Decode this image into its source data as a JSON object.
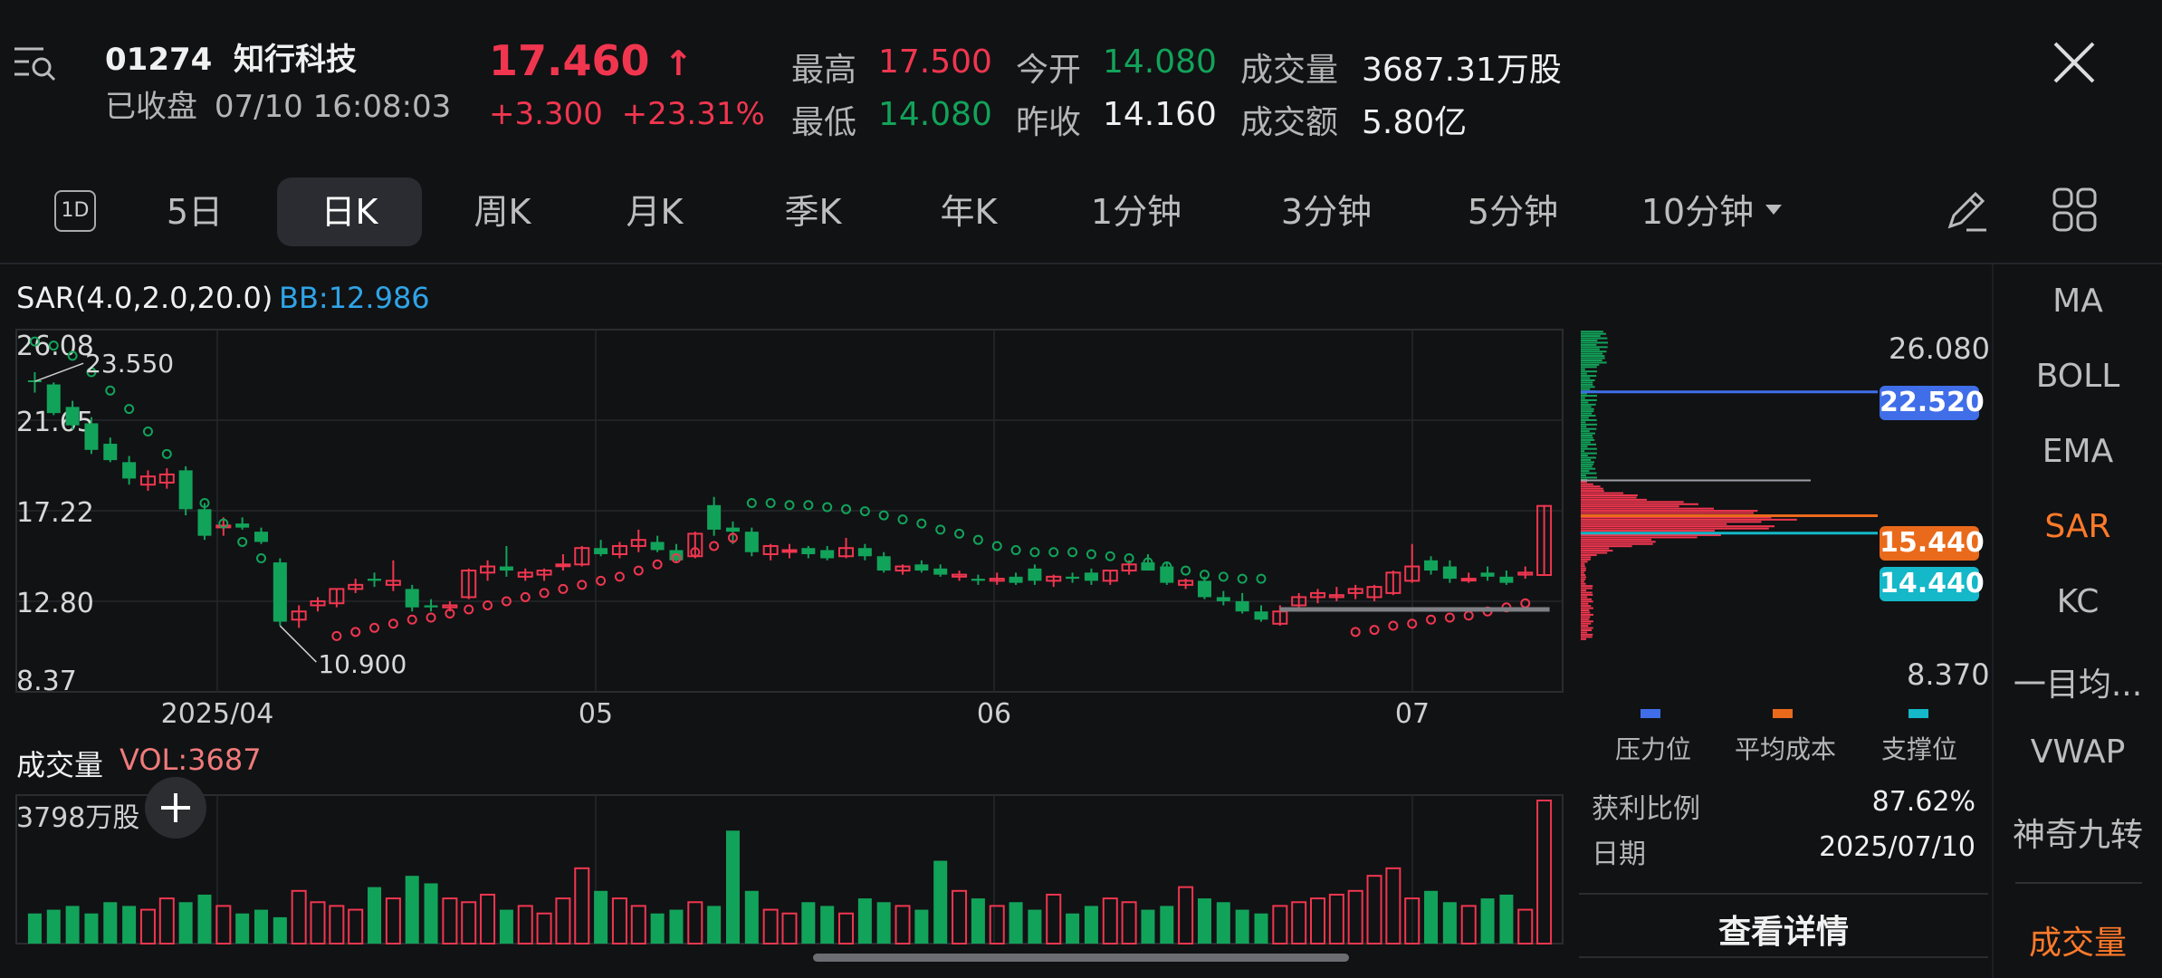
{
  "header": {
    "code": "01274",
    "name": "知行科技",
    "status": "已收盘",
    "datetime": "07/10 16:08:03",
    "price": "17.460",
    "change": "+3.300",
    "change_pct": "+23.31%",
    "stats": {
      "high_label": "最高",
      "high": "17.500",
      "open_label": "今开",
      "open": "14.080",
      "vol_label": "成交量",
      "vol": "3687.31万股",
      "low_label": "最低",
      "low": "14.080",
      "prev_label": "昨收",
      "prev": "14.160",
      "amt_label": "成交额",
      "amt": "5.80亿"
    }
  },
  "tabs": {
    "oned": "1D",
    "items": [
      "5日",
      "日K",
      "周K",
      "月K",
      "季K",
      "年K",
      "1分钟",
      "3分钟",
      "5分钟",
      "10分钟"
    ],
    "active": "日K"
  },
  "indicator": {
    "label": "SAR(4.0,2.0,20.0)",
    "bb": "BB:12.986"
  },
  "volume_panel": {
    "label": "成交量",
    "vol": "VOL:3687",
    "scale": "3798万股"
  },
  "right_menu": [
    "MA",
    "BOLL",
    "EMA",
    "SAR",
    "KC",
    "一目均...",
    "VWAP",
    "神奇九转"
  ],
  "right_menu_active": "SAR",
  "bottom_menu": "成交量",
  "chip": {
    "top": "26.080",
    "bottom": "8.370",
    "pressure": "22.520",
    "avg_cost": "15.440",
    "support": "14.440",
    "legend": [
      "压力位",
      "平均成本",
      "支撑位"
    ],
    "profit_label": "获利比例",
    "profit": "87.62%",
    "date_label": "日期",
    "date": "2025/07/10",
    "detail": "查看详情"
  },
  "chart_data": {
    "type": "candlestick",
    "y_ticks": [
      "26.08",
      "21.65",
      "17.22",
      "12.80",
      "8.37"
    ],
    "ylim": [
      8.37,
      26.08
    ],
    "x_ticks": [
      "2025/04",
      "05",
      "06",
      "07"
    ],
    "annotations": {
      "high": "23.550",
      "low": "10.900"
    },
    "candles": [
      [
        23.6,
        24.0,
        23.0,
        23.55
      ],
      [
        23.4,
        23.5,
        21.9,
        22.0
      ],
      [
        22.3,
        22.6,
        21.2,
        21.4
      ],
      [
        21.5,
        21.8,
        20.0,
        20.2
      ],
      [
        20.5,
        20.8,
        19.6,
        19.7
      ],
      [
        19.6,
        19.9,
        18.5,
        18.8
      ],
      [
        18.5,
        19.2,
        18.2,
        18.9
      ],
      [
        18.6,
        19.3,
        18.3,
        19.0
      ],
      [
        19.2,
        19.4,
        17.0,
        17.3
      ],
      [
        17.3,
        17.6,
        15.8,
        16.0
      ],
      [
        16.5,
        16.9,
        16.0,
        16.5
      ],
      [
        16.6,
        16.9,
        16.3,
        16.4
      ],
      [
        16.2,
        16.4,
        15.6,
        15.7
      ],
      [
        14.7,
        14.9,
        11.6,
        11.8
      ],
      [
        11.9,
        12.6,
        11.5,
        12.3
      ],
      [
        12.6,
        13.0,
        12.3,
        12.8
      ],
      [
        12.7,
        13.4,
        12.5,
        13.4
      ],
      [
        13.4,
        13.9,
        13.2,
        13.6
      ],
      [
        13.9,
        14.2,
        13.5,
        13.8
      ],
      [
        13.6,
        14.8,
        13.3,
        13.8
      ],
      [
        13.4,
        13.6,
        12.3,
        12.5
      ],
      [
        12.6,
        12.9,
        12.3,
        12.5
      ],
      [
        12.5,
        12.8,
        12.3,
        12.6
      ],
      [
        13.0,
        14.4,
        12.9,
        14.3
      ],
      [
        14.2,
        14.8,
        13.8,
        14.5
      ],
      [
        14.5,
        15.5,
        14.0,
        14.3
      ],
      [
        14.0,
        14.4,
        13.8,
        14.2
      ],
      [
        14.1,
        14.4,
        13.8,
        14.3
      ],
      [
        14.6,
        15.1,
        14.3,
        14.6
      ],
      [
        14.6,
        15.5,
        14.5,
        15.4
      ],
      [
        15.4,
        15.8,
        15.0,
        15.1
      ],
      [
        15.1,
        15.7,
        14.9,
        15.5
      ],
      [
        15.5,
        16.3,
        15.2,
        15.8
      ],
      [
        15.7,
        16.0,
        15.2,
        15.3
      ],
      [
        15.3,
        15.6,
        14.7,
        14.8
      ],
      [
        15.0,
        16.2,
        14.9,
        16.1
      ],
      [
        17.5,
        17.9,
        16.0,
        16.3
      ],
      [
        16.4,
        16.7,
        15.6,
        16.2
      ],
      [
        16.2,
        16.4,
        15.0,
        15.2
      ],
      [
        15.1,
        15.6,
        14.8,
        15.5
      ],
      [
        15.3,
        15.6,
        14.9,
        15.3
      ],
      [
        15.4,
        15.5,
        14.9,
        15.1
      ],
      [
        15.3,
        15.5,
        14.8,
        14.9
      ],
      [
        15.0,
        15.9,
        14.9,
        15.4
      ],
      [
        15.4,
        15.6,
        14.8,
        15.0
      ],
      [
        15.0,
        15.2,
        14.2,
        14.3
      ],
      [
        14.3,
        14.6,
        14.1,
        14.5
      ],
      [
        14.6,
        14.8,
        14.2,
        14.3
      ],
      [
        14.4,
        14.6,
        14.0,
        14.1
      ],
      [
        14.0,
        14.3,
        13.8,
        14.1
      ],
      [
        13.9,
        14.1,
        13.6,
        13.8
      ],
      [
        13.8,
        14.2,
        13.6,
        13.9
      ],
      [
        14.0,
        14.2,
        13.6,
        13.7
      ],
      [
        14.4,
        14.6,
        13.6,
        13.8
      ],
      [
        13.8,
        14.1,
        13.5,
        14.0
      ],
      [
        14.0,
        14.2,
        13.7,
        13.9
      ],
      [
        14.2,
        14.4,
        13.6,
        13.8
      ],
      [
        13.8,
        14.3,
        13.6,
        14.3
      ],
      [
        14.3,
        14.8,
        14.1,
        14.6
      ],
      [
        14.7,
        15.1,
        14.3,
        14.3
      ],
      [
        14.5,
        14.7,
        13.6,
        13.7
      ],
      [
        13.6,
        13.9,
        13.4,
        13.8
      ],
      [
        13.8,
        14.0,
        12.9,
        13.0
      ],
      [
        13.0,
        13.3,
        12.6,
        12.8
      ],
      [
        12.8,
        13.2,
        12.2,
        12.3
      ],
      [
        12.3,
        12.6,
        11.8,
        11.9
      ],
      [
        11.7,
        12.6,
        11.6,
        12.3
      ],
      [
        12.6,
        13.2,
        12.4,
        13.0
      ],
      [
        13.0,
        13.4,
        12.7,
        13.2
      ],
      [
        13.0,
        13.5,
        12.8,
        13.1
      ],
      [
        13.2,
        13.6,
        12.9,
        13.4
      ],
      [
        13.0,
        13.6,
        12.8,
        13.5
      ],
      [
        13.2,
        14.3,
        13.1,
        14.2
      ],
      [
        13.8,
        15.6,
        13.7,
        14.5
      ],
      [
        14.8,
        15.0,
        14.1,
        14.3
      ],
      [
        14.5,
        14.8,
        13.7,
        13.9
      ],
      [
        13.9,
        14.2,
        13.7,
        13.9
      ],
      [
        14.2,
        14.5,
        13.8,
        14.0
      ],
      [
        14.0,
        14.3,
        13.6,
        13.7
      ],
      [
        14.1,
        14.5,
        13.9,
        14.2
      ],
      [
        14.08,
        17.5,
        14.08,
        17.46
      ]
    ],
    "sar": [
      {
        "start": 0,
        "values": [
          25.5,
          25.3,
          24.8,
          24.0,
          23.1,
          22.2,
          21.1,
          20.0,
          18.9,
          17.6,
          16.6,
          15.7,
          14.9,
          14.2
        ]
      },
      {
        "start": 16,
        "values": [
          11.1,
          11.3,
          11.5,
          11.7,
          11.9,
          12.0,
          12.2,
          12.4,
          12.6,
          12.8,
          13.0,
          13.2,
          13.4,
          13.6,
          13.8,
          14.0,
          14.3,
          14.6,
          14.9,
          15.2,
          15.5,
          15.9
        ]
      },
      {
        "start": 38,
        "values": [
          17.6,
          17.6,
          17.5,
          17.5,
          17.4,
          17.3,
          17.2,
          17.0,
          16.8,
          16.6,
          16.3,
          16.1,
          15.8,
          15.5,
          15.3,
          15.2,
          15.2,
          15.2,
          15.1,
          15.0,
          14.9,
          14.7,
          14.5,
          14.3,
          14.1,
          14.0,
          13.9,
          13.9
        ]
      },
      {
        "start": 70,
        "values": [
          11.3,
          11.4,
          11.6,
          11.7,
          11.9,
          12.0,
          12.1,
          12.3,
          12.5,
          12.7
        ]
      }
    ],
    "volume": [
      8,
      9,
      10,
      8,
      11,
      10,
      9,
      12,
      11,
      13,
      10,
      8,
      9,
      7,
      14,
      11,
      10,
      9,
      15,
      12,
      18,
      16,
      12,
      11,
      13,
      9,
      10,
      8,
      12,
      20,
      14,
      12,
      10,
      8,
      9,
      11,
      10,
      30,
      14,
      9,
      8,
      11,
      10,
      8,
      12,
      11,
      10,
      9,
      22,
      14,
      12,
      10,
      11,
      9,
      13,
      8,
      10,
      12,
      11,
      9,
      10,
      15,
      12,
      11,
      9,
      8,
      10,
      11,
      12,
      13,
      14,
      18,
      20,
      12,
      14,
      11,
      10,
      12,
      13,
      9,
      38
    ],
    "volume_max": 38
  }
}
